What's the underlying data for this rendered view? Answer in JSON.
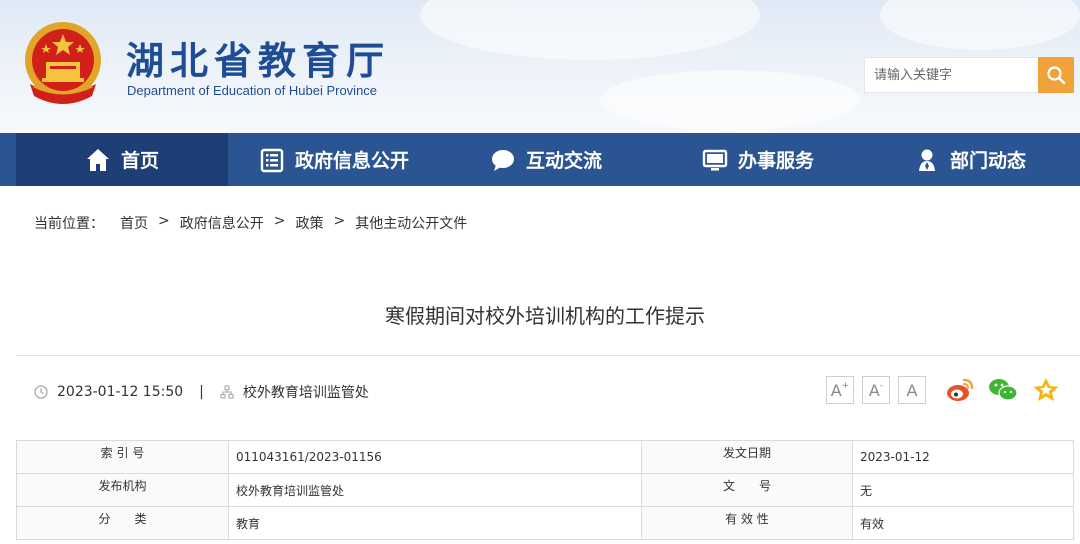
{
  "header": {
    "title": "湖北省教育厅",
    "subtitle": "Department of Education of Hubei Province",
    "search_placeholder": "请输入关键字"
  },
  "nav": {
    "items": [
      {
        "label": "首页",
        "icon": "home-icon",
        "active": true
      },
      {
        "label": "政府信息公开",
        "icon": "document-list-icon",
        "active": false
      },
      {
        "label": "互动交流",
        "icon": "chat-bubble-icon",
        "active": false
      },
      {
        "label": "办事服务",
        "icon": "monitor-icon",
        "active": false
      },
      {
        "label": "部门动态",
        "icon": "person-pin-icon",
        "active": false
      }
    ]
  },
  "breadcrumb": {
    "label": "当前位置：",
    "items": [
      "首页",
      "政府信息公开",
      "政策",
      "其他主动公开文件"
    ],
    "separator": ">"
  },
  "article": {
    "title": "寒假期间对校外培训机构的工作提示",
    "datetime": "2023-01-12 15:50",
    "divider": "|",
    "department": "校外教育培训监管处"
  },
  "font_controls": {
    "large": "A",
    "medium": "A",
    "small": "A",
    "plus": "+",
    "minus": "-"
  },
  "info": {
    "rows": [
      {
        "k1": "索 引 号",
        "v1": "011043161/2023-01156",
        "k2": "发文日期",
        "v2": "2023-01-12"
      },
      {
        "k1": "发布机构",
        "v1": "校外教育培训监管处",
        "k2": "文　　号",
        "v2": "无"
      },
      {
        "k1": "分　　类",
        "v1": "教育",
        "k2": "有 效 性",
        "v2": "有效"
      }
    ]
  },
  "colors": {
    "nav_bg": "#2b5592",
    "nav_active": "#1d3f75",
    "search_btn": "#f0a33a",
    "title_blue": "#1f4d95"
  }
}
